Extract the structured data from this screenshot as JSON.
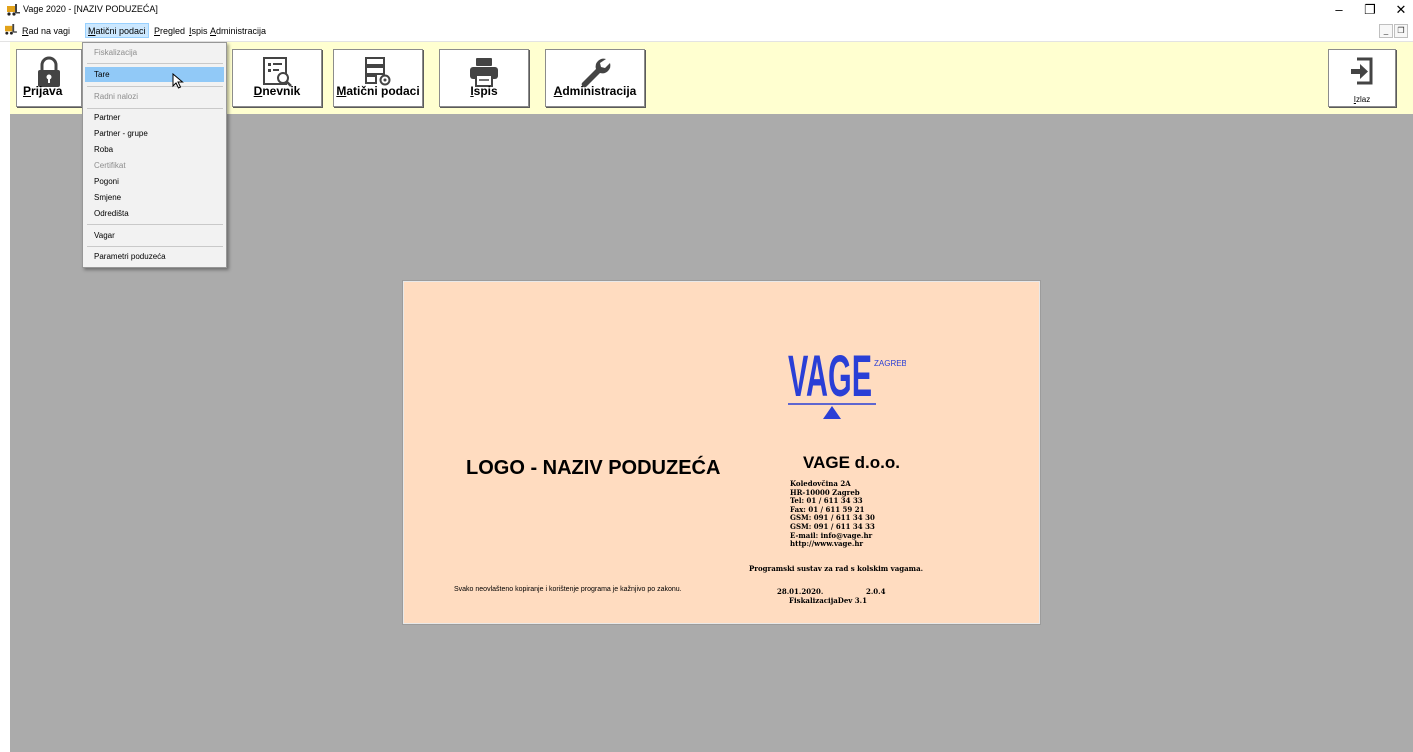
{
  "window": {
    "title": "Vage 2020 - [NAZIV PODUZEĆA]",
    "controls": {
      "minimize": "–",
      "maximize": "❐",
      "close": "✕"
    },
    "mdi_controls": {
      "minimize": "_",
      "restore": "❐"
    }
  },
  "menubar": {
    "items": [
      {
        "key": "R",
        "rest": "ad na vagi"
      },
      {
        "key": "M",
        "rest": "atični podaci",
        "active": true
      },
      {
        "key": "P",
        "rest": "regled"
      },
      {
        "key": "I",
        "rest": "spis"
      },
      {
        "key": "A",
        "rest": "dministracija"
      }
    ]
  },
  "toolbar": {
    "buttons": [
      {
        "key": "P",
        "rest": "rijava",
        "icon": "lock-icon"
      },
      {
        "key": "D",
        "rest": "nevnik",
        "icon": "journal-icon"
      },
      {
        "key": "M",
        "rest": "atični podaci",
        "icon": "master-data-icon"
      },
      {
        "key": "I",
        "rest": "spis",
        "icon": "printer-icon"
      },
      {
        "key": "A",
        "rest": "dministracija",
        "icon": "wrench-icon"
      }
    ],
    "exit": {
      "key": "I",
      "rest": "zlaz",
      "icon": "exit-icon"
    }
  },
  "dropdown": {
    "items": [
      {
        "label": "Fiskalizacija",
        "disabled": true
      },
      {
        "label": "Tare",
        "highlighted": true
      },
      {
        "label": "Radni nalozi",
        "disabled": true
      },
      {
        "label": "Partner"
      },
      {
        "label": "Partner - grupe"
      },
      {
        "label": "Roba"
      },
      {
        "label": "Certifikat",
        "disabled": true
      },
      {
        "label": "Pogoni"
      },
      {
        "label": "Smjene"
      },
      {
        "label": "Odredišta"
      },
      {
        "label": "Vagar"
      },
      {
        "label": "Parametri poduzeća"
      }
    ]
  },
  "splash": {
    "logo_text": "VAGE",
    "logo_sub": "ZAGREB",
    "main_title": "LOGO -  NAZIV PODUZEĆA",
    "company": "VAGE d.o.o.",
    "address_lines": [
      "Koledovčina 2A",
      "HR-10000 Zagreb",
      "Tel:     01 / 611 34 33",
      "Fax:     01 / 611 59 21",
      "GSM:  091 / 611 34 30",
      "GSM:  091 / 611 34 33",
      "E-mail: info@vage.hr",
      "http://www.vage.hr"
    ],
    "tagline": "Programski sustav za rad s kolskim vagama.",
    "copyright": "Svako neovlašteno kopiranje i korištenje programa je kažnjivo po zakonu.",
    "date": "28.01.2020.",
    "version": "2.0.4",
    "build": "FiskalizacijaDev 3.1"
  },
  "colors": {
    "toolbar_bg": "#ffffd0",
    "workspace_bg": "#ababab",
    "splash_bg": "#ffdcc0",
    "logo_blue": "#2a3fd6",
    "menu_highlight": "#91c9f7"
  }
}
